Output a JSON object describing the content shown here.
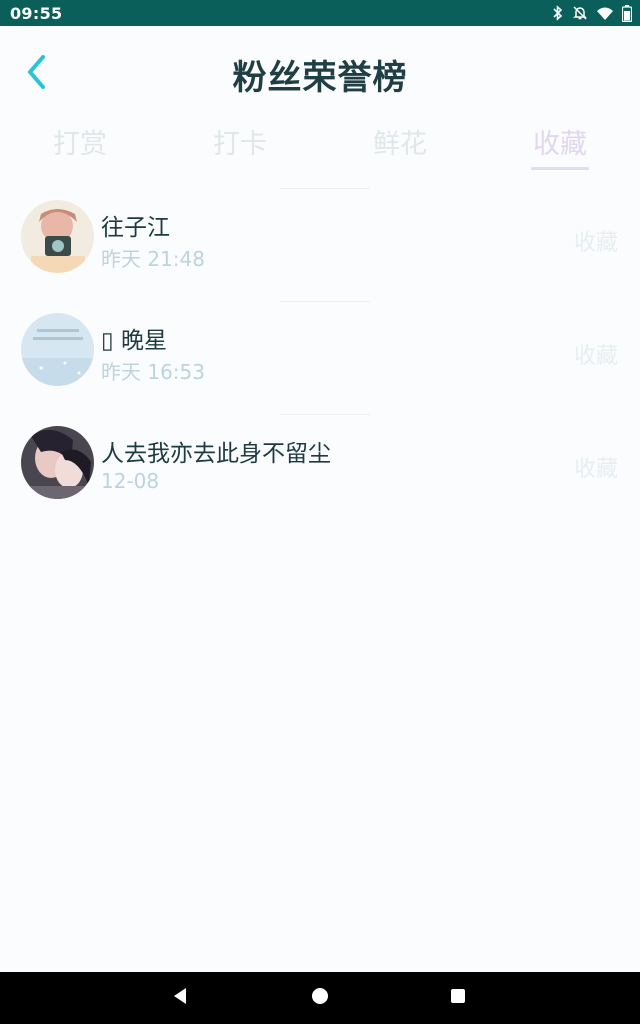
{
  "status_bar": {
    "time": "09:55",
    "icons": [
      "bluetooth-icon",
      "notifications-off-icon",
      "wifi-icon",
      "battery-icon"
    ]
  },
  "header": {
    "title": "粉丝荣誉榜",
    "back_icon": "chevron-left-icon"
  },
  "tabs": [
    {
      "label": "打赏",
      "active": false
    },
    {
      "label": "打卡",
      "active": false
    },
    {
      "label": "鲜花",
      "active": false
    },
    {
      "label": "收藏",
      "active": true
    }
  ],
  "list": [
    {
      "name": "往子江",
      "time": "昨天 21:48",
      "action": "收藏"
    },
    {
      "name": "▯ 晚星",
      "time": "昨天 16:53",
      "action": "收藏"
    },
    {
      "name": "人去我亦去此身不留尘",
      "time": "12-08",
      "action": "收藏"
    }
  ],
  "nav_bar": {
    "buttons": [
      "back-triangle-icon",
      "home-circle-icon",
      "recents-square-icon"
    ]
  },
  "colors": {
    "status_bar": "#0b5f5a",
    "accent": "#27c3d6",
    "title": "#1f3f44",
    "active_tab": "#e2d7ef"
  }
}
